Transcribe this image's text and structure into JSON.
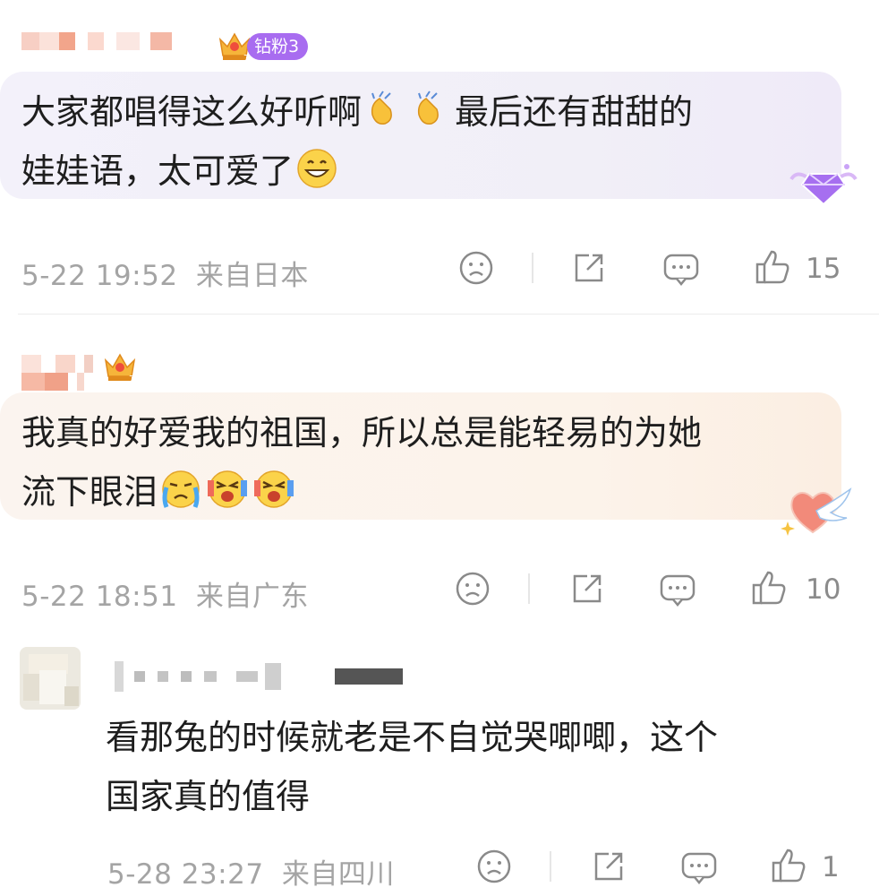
{
  "comments": [
    {
      "badge_label": "钻粉3",
      "text_line1": "大家都唱得这么好听啊",
      "text_line1b": "最后还有甜甜的",
      "text_line2": "娃娃语，太可爱了",
      "timestamp": "5-22 19:52",
      "location": "来自日本",
      "likes": "15"
    },
    {
      "text_line1": "我真的好爱我的祖国，所以总是能轻易的为她",
      "text_line2": "流下眼泪",
      "timestamp": "5-22 18:51",
      "location": "来自广东",
      "likes": "10"
    }
  ],
  "reply": {
    "text_line1": "看那兔的时候就老是不自觉哭唧唧，这个",
    "text_line2": "国家真的值得",
    "timestamp": "5-28 23:27",
    "location": "来自四川",
    "likes": "1"
  },
  "icons": {
    "dislike": "frown-face-icon",
    "share": "share-icon",
    "comment": "comment-icon",
    "like": "thumbs-up-icon"
  },
  "colors": {
    "fan_badge": "#a86cf0",
    "meta_text": "#a4a4a4",
    "icon_stroke": "#8a8a8a"
  }
}
